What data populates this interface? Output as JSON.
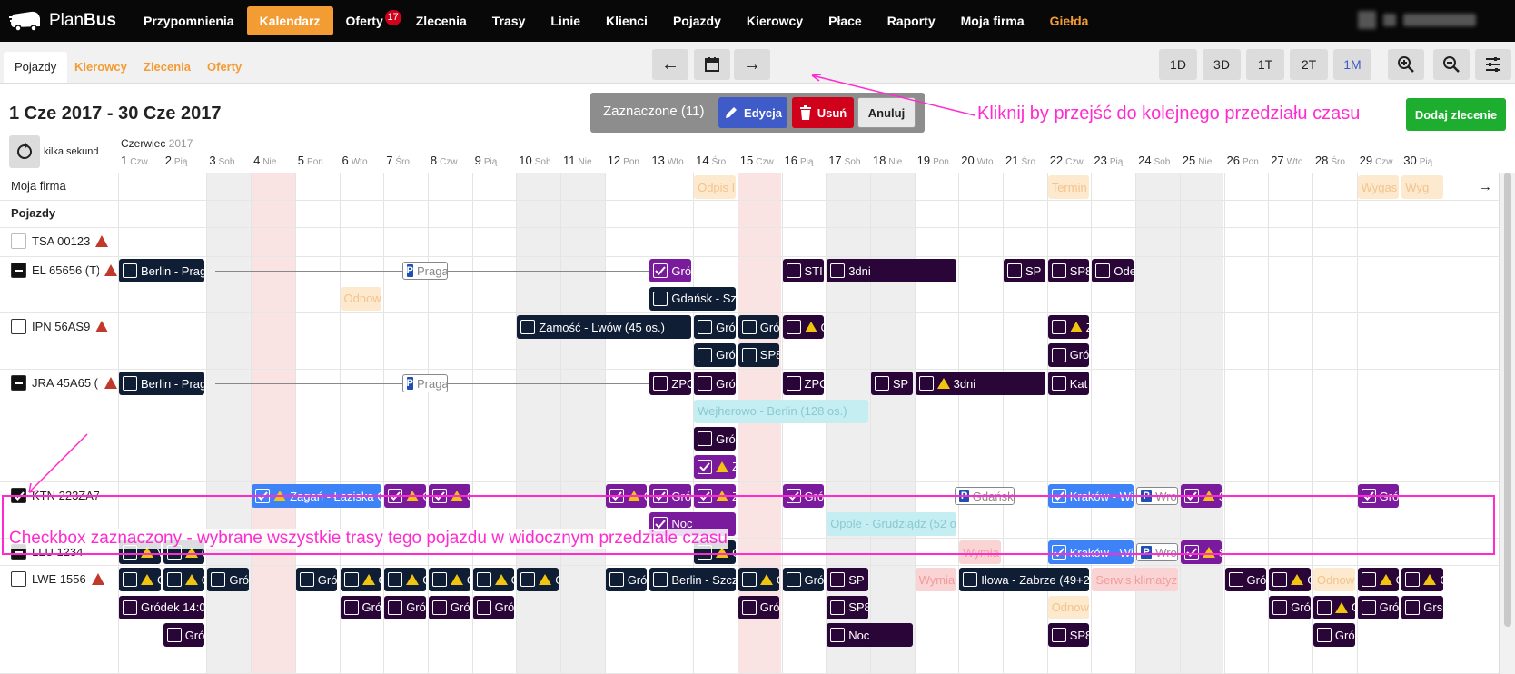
{
  "app": {
    "logo_text_1": "Plan",
    "logo_text_2": "Bus"
  },
  "nav": [
    {
      "label": "Przypomnienia"
    },
    {
      "label": "Kalendarz",
      "active": true
    },
    {
      "label": "Oferty",
      "badge": "17"
    },
    {
      "label": "Zlecenia"
    },
    {
      "label": "Trasy"
    },
    {
      "label": "Linie"
    },
    {
      "label": "Klienci"
    },
    {
      "label": "Pojazdy"
    },
    {
      "label": "Kierowcy"
    },
    {
      "label": "Płace"
    },
    {
      "label": "Raporty"
    },
    {
      "label": "Moja firma"
    },
    {
      "label": "Giełda",
      "gielda": true
    }
  ],
  "tabs": [
    {
      "label": "Pojazdy",
      "active": true
    },
    {
      "label": "Kierowcy"
    },
    {
      "label": "Zlecenia"
    },
    {
      "label": "Oferty"
    }
  ],
  "views": [
    "1D",
    "3D",
    "1T",
    "2T",
    "1M"
  ],
  "selected_view": "1M",
  "date_range": "1 Cze 2017 - 30 Cze 2017",
  "selection": {
    "label": "Zaznaczone (11)",
    "edit": "Edycja",
    "delete": "Usuń",
    "cancel": "Anuluj"
  },
  "add_button": "Dodaj zlecenie",
  "refresh_label": "kilka sekund",
  "month": {
    "name": "Czerwiec",
    "year": "2017"
  },
  "annotations": {
    "next": "Kliknij by przejść do kolejnego przedziału czasu",
    "checkbox": "Checkbox zaznaczony - wybrane wszystkie trasy tego pojazdu w widocznym przedziale czasu"
  },
  "days": [
    {
      "n": "1",
      "d": "Czw"
    },
    {
      "n": "2",
      "d": "Pią"
    },
    {
      "n": "3",
      "d": "Sob"
    },
    {
      "n": "4",
      "d": "Nie"
    },
    {
      "n": "5",
      "d": "Pon"
    },
    {
      "n": "6",
      "d": "Wto"
    },
    {
      "n": "7",
      "d": "Śro"
    },
    {
      "n": "8",
      "d": "Czw"
    },
    {
      "n": "9",
      "d": "Pią"
    },
    {
      "n": "10",
      "d": "Sob"
    },
    {
      "n": "11",
      "d": "Nie"
    },
    {
      "n": "12",
      "d": "Pon"
    },
    {
      "n": "13",
      "d": "Wto"
    },
    {
      "n": "14",
      "d": "Śro"
    },
    {
      "n": "15",
      "d": "Czw"
    },
    {
      "n": "16",
      "d": "Pią"
    },
    {
      "n": "17",
      "d": "Sob"
    },
    {
      "n": "18",
      "d": "Nie"
    },
    {
      "n": "19",
      "d": "Pon"
    },
    {
      "n": "20",
      "d": "Wto"
    },
    {
      "n": "21",
      "d": "Śro"
    },
    {
      "n": "22",
      "d": "Czw"
    },
    {
      "n": "23",
      "d": "Pią"
    },
    {
      "n": "24",
      "d": "Sob"
    },
    {
      "n": "25",
      "d": "Nie"
    },
    {
      "n": "26",
      "d": "Pon"
    },
    {
      "n": "27",
      "d": "Wto"
    },
    {
      "n": "28",
      "d": "Śro"
    },
    {
      "n": "29",
      "d": "Czw"
    },
    {
      "n": "30",
      "d": "Pią"
    }
  ],
  "rows": {
    "firma": "Moja firma",
    "section": "Pojazdy",
    "vehicles": [
      "TSA 00123",
      "EL 65656 (T)",
      "IPN 56AS9",
      "JRA 45A65 (I",
      "KTN 223ZA7",
      "LLU 1234",
      "LWE 1556"
    ]
  },
  "events": [
    {
      "day": 14,
      "len": 1,
      "lane": 0,
      "row": "firma",
      "style": "peach",
      "text": "Odpis I"
    },
    {
      "day": 22,
      "len": 1,
      "lane": 0,
      "row": "firma",
      "style": "peach",
      "text": "Termin"
    },
    {
      "day": 29,
      "len": 1,
      "lane": 0,
      "row": "firma",
      "style": "peach",
      "text": "Wygas"
    },
    {
      "day": 30,
      "len": 1,
      "lane": 0,
      "row": "firma",
      "style": "peach",
      "text": "Wyg"
    },
    {
      "day": 1,
      "len": 2,
      "lane": 0,
      "row": 1,
      "style": "navy",
      "cb": "off",
      "text": "Berlin - Prag"
    },
    {
      "day": 7.4,
      "len": 1.1,
      "lane": 0,
      "row": 1,
      "style": "park",
      "text": "Praga"
    },
    {
      "day": 13,
      "len": 1,
      "lane": 0,
      "row": 1,
      "style": "purp",
      "cb": "on",
      "text": "Gró"
    },
    {
      "day": 16,
      "len": 1,
      "lane": 0,
      "row": 1,
      "style": "dkp",
      "cb": "off",
      "text": "STI"
    },
    {
      "day": 17,
      "len": 3,
      "lane": 0,
      "row": 1,
      "style": "dkp",
      "cb": "off",
      "text": "3dni"
    },
    {
      "day": 21,
      "len": 1,
      "lane": 0,
      "row": 1,
      "style": "dkp",
      "cb": "off",
      "text": "SP"
    },
    {
      "day": 22,
      "len": 1,
      "lane": 0,
      "row": 1,
      "style": "dkp",
      "cb": "off",
      "text": "SP8"
    },
    {
      "day": 23,
      "len": 1,
      "lane": 0,
      "row": 1,
      "style": "dkp",
      "cb": "off",
      "text": "Ode"
    },
    {
      "day": 6,
      "len": 1,
      "lane": 1,
      "row": 1,
      "style": "peach",
      "text": "Odnow"
    },
    {
      "day": 13,
      "len": 2,
      "lane": 1,
      "row": 1,
      "style": "navy",
      "cb": "off",
      "text": "Gdańsk - Szc"
    },
    {
      "day": 10,
      "len": 4,
      "lane": 0,
      "row": 2,
      "style": "navy",
      "cb": "off",
      "text": "Zamość - Lwów (45 os.)"
    },
    {
      "day": 14,
      "len": 1,
      "lane": 0,
      "row": 2,
      "style": "navy",
      "cb": "off",
      "text": "Gró"
    },
    {
      "day": 15,
      "len": 1,
      "lane": 0,
      "row": 2,
      "style": "navy",
      "cb": "off",
      "text": "Gró"
    },
    {
      "day": 16,
      "len": 1,
      "lane": 0,
      "row": 2,
      "style": "dkp",
      "cb": "off",
      "warn": true,
      "text": "G"
    },
    {
      "day": 22,
      "len": 1,
      "lane": 0,
      "row": 2,
      "style": "dkp",
      "cb": "off",
      "warn": true,
      "text": "Z"
    },
    {
      "day": 14,
      "len": 1,
      "lane": 1,
      "row": 2,
      "style": "navy",
      "cb": "off",
      "text": "Gró"
    },
    {
      "day": 15,
      "len": 1,
      "lane": 1,
      "row": 2,
      "style": "navy",
      "cb": "off",
      "text": "SP8"
    },
    {
      "day": 22,
      "len": 1,
      "lane": 1,
      "row": 2,
      "style": "dkp",
      "cb": "off",
      "text": "Gró"
    },
    {
      "day": 1,
      "len": 2,
      "lane": 0,
      "row": 3,
      "style": "navy",
      "cb": "off",
      "text": "Berlin - Prag"
    },
    {
      "day": 7.4,
      "len": 1.1,
      "lane": 0,
      "row": 3,
      "style": "park",
      "text": "Praga"
    },
    {
      "day": 13,
      "len": 1,
      "lane": 0,
      "row": 3,
      "style": "dkp",
      "cb": "off",
      "text": "ZPC"
    },
    {
      "day": 14,
      "len": 1,
      "lane": 0,
      "row": 3,
      "style": "dkp",
      "cb": "off",
      "text": "Gró"
    },
    {
      "day": 16,
      "len": 1,
      "lane": 0,
      "row": 3,
      "style": "dkp",
      "cb": "off",
      "text": "ZPC"
    },
    {
      "day": 18,
      "len": 1,
      "lane": 0,
      "row": 3,
      "style": "dkp",
      "cb": "off",
      "text": "SP"
    },
    {
      "day": 19,
      "len": 3,
      "lane": 0,
      "row": 3,
      "style": "dkp",
      "cb": "off",
      "warn": true,
      "text": "3dni"
    },
    {
      "day": 22,
      "len": 1,
      "lane": 0,
      "row": 3,
      "style": "dkp",
      "cb": "off",
      "text": "Kat"
    },
    {
      "day": 14,
      "len": 4,
      "lane": 1,
      "row": 3,
      "style": "cyan",
      "text": "Wejherowo - Berlin (128 os.)"
    },
    {
      "day": 14,
      "len": 1,
      "lane": 2,
      "row": 3,
      "style": "dkp",
      "cb": "off",
      "text": "Gró"
    },
    {
      "day": 14,
      "len": 1,
      "lane": 3,
      "row": 3,
      "style": "purp",
      "cb": "on",
      "warn": true,
      "text": "Z"
    },
    {
      "day": 4,
      "len": 3,
      "lane": 0,
      "row": 4,
      "style": "blue",
      "cb": "on",
      "warn": true,
      "text": "Żagań - Łaziska Gó"
    },
    {
      "day": 7,
      "len": 1,
      "lane": 0,
      "row": 4,
      "style": "purp",
      "cb": "on",
      "warn": true,
      "text": "G"
    },
    {
      "day": 8,
      "len": 1,
      "lane": 0,
      "row": 4,
      "style": "purp",
      "cb": "on",
      "warn": true,
      "text": "G"
    },
    {
      "day": 12,
      "len": 1,
      "lane": 0,
      "row": 4,
      "style": "purp",
      "cb": "on",
      "warn": true,
      "text": "G"
    },
    {
      "day": 13,
      "len": 1,
      "lane": 0,
      "row": 4,
      "style": "purp",
      "cb": "on",
      "text": "Gró"
    },
    {
      "day": 14,
      "len": 1,
      "lane": 0,
      "row": 4,
      "style": "purp",
      "cb": "on",
      "warn": true,
      "text": "Z"
    },
    {
      "day": 16,
      "len": 1,
      "lane": 0,
      "row": 4,
      "style": "purp",
      "cb": "on",
      "text": "Gró"
    },
    {
      "day": 19.9,
      "len": 1.4,
      "lane": 0,
      "row": 4,
      "style": "park",
      "text": "Gdańsk"
    },
    {
      "day": 22,
      "len": 2,
      "lane": 0,
      "row": 4,
      "style": "blue",
      "cb": "on",
      "text": "Kraków - Wi"
    },
    {
      "day": 24,
      "len": 1,
      "lane": 0,
      "row": 4,
      "style": "park",
      "text": "Wro"
    },
    {
      "day": 25,
      "len": 1,
      "lane": 0,
      "row": 4,
      "style": "purp",
      "cb": "on",
      "warn": true,
      "text": "S"
    },
    {
      "day": 29,
      "len": 1,
      "lane": 0,
      "row": 4,
      "style": "purp",
      "cb": "on",
      "text": "Gró"
    },
    {
      "day": 13,
      "len": 2,
      "lane": 1,
      "row": 4,
      "style": "purp",
      "cb": "on",
      "text": "Noc"
    },
    {
      "day": 17,
      "len": 3,
      "lane": 1,
      "row": 4,
      "style": "cyan",
      "text": "Opole - Grudziądz (52 os."
    },
    {
      "day": 1,
      "len": 1,
      "lane": 0,
      "row": 5,
      "style": "navy",
      "cb": "off",
      "warn": true,
      "text": "V"
    },
    {
      "day": 2,
      "len": 1,
      "lane": 0,
      "row": 5,
      "style": "navy",
      "cb": "off",
      "warn": true,
      "text": "G"
    },
    {
      "day": 14,
      "len": 1,
      "lane": 0,
      "row": 5,
      "style": "navy",
      "cb": "off",
      "warn": true,
      "text": "G"
    },
    {
      "day": 20,
      "len": 1,
      "lane": 0,
      "row": 5,
      "style": "pink",
      "text": "Wymia"
    },
    {
      "day": 22,
      "len": 2,
      "lane": 0,
      "row": 5,
      "style": "blue",
      "cb": "on",
      "text": "Kraków - Wi"
    },
    {
      "day": 24,
      "len": 1,
      "lane": 0,
      "row": 5,
      "style": "park",
      "text": "Wro"
    },
    {
      "day": 25,
      "len": 1,
      "lane": 0,
      "row": 5,
      "style": "purp",
      "cb": "on",
      "warn": true,
      "text": "S"
    },
    {
      "day": 1,
      "len": 1,
      "lane": 0,
      "row": 6,
      "style": "navy",
      "cb": "off",
      "warn": true,
      "text": "G"
    },
    {
      "day": 2,
      "len": 1,
      "lane": 0,
      "row": 6,
      "style": "navy",
      "cb": "off",
      "warn": true,
      "text": "G"
    },
    {
      "day": 3,
      "len": 1,
      "lane": 0,
      "row": 6,
      "style": "navy",
      "cb": "off",
      "text": "Gró"
    },
    {
      "day": 5,
      "len": 1,
      "lane": 0,
      "row": 6,
      "style": "navy",
      "cb": "off",
      "text": "Gró"
    },
    {
      "day": 6,
      "len": 1,
      "lane": 0,
      "row": 6,
      "style": "navy",
      "cb": "off",
      "warn": true,
      "text": "G"
    },
    {
      "day": 7,
      "len": 1,
      "lane": 0,
      "row": 6,
      "style": "navy",
      "cb": "off",
      "warn": true,
      "text": "G"
    },
    {
      "day": 8,
      "len": 1,
      "lane": 0,
      "row": 6,
      "style": "navy",
      "cb": "off",
      "warn": true,
      "text": "G"
    },
    {
      "day": 9,
      "len": 1,
      "lane": 0,
      "row": 6,
      "style": "navy",
      "cb": "off",
      "warn": true,
      "text": "G"
    },
    {
      "day": 10,
      "len": 1,
      "lane": 0,
      "row": 6,
      "style": "navy",
      "cb": "off",
      "warn": true,
      "text": "G"
    },
    {
      "day": 12,
      "len": 1,
      "lane": 0,
      "row": 6,
      "style": "navy",
      "cb": "off",
      "text": "Gró"
    },
    {
      "day": 13,
      "len": 2,
      "lane": 0,
      "row": 6,
      "style": "navy",
      "cb": "off",
      "text": "Berlin - Szcz"
    },
    {
      "day": 15,
      "len": 1,
      "lane": 0,
      "row": 6,
      "style": "navy",
      "cb": "off",
      "warn": true,
      "text": "G"
    },
    {
      "day": 16,
      "len": 1,
      "lane": 0,
      "row": 6,
      "style": "navy",
      "cb": "off",
      "text": "Gró"
    },
    {
      "day": 17,
      "len": 1,
      "lane": 0,
      "row": 6,
      "style": "dkp",
      "cb": "off",
      "text": "SP"
    },
    {
      "day": 19,
      "len": 1,
      "lane": 0,
      "row": 6,
      "style": "pink",
      "text": "Wymia"
    },
    {
      "day": 20,
      "len": 3,
      "lane": 0,
      "row": 6,
      "style": "navy",
      "cb": "off",
      "text": "Iłowa - Zabrze (49+2"
    },
    {
      "day": 23,
      "len": 2,
      "lane": 0,
      "row": 6,
      "style": "pink",
      "text": "Serwis klimatyz"
    },
    {
      "day": 26,
      "len": 1,
      "lane": 0,
      "row": 6,
      "style": "dkp",
      "cb": "off",
      "text": "Gró"
    },
    {
      "day": 27,
      "len": 1,
      "lane": 0,
      "row": 6,
      "style": "dkp",
      "cb": "off",
      "warn": true,
      "text": "G"
    },
    {
      "day": 28,
      "len": 1,
      "lane": 0,
      "row": 6,
      "style": "peach",
      "text": "Odnow"
    },
    {
      "day": 29,
      "len": 1,
      "lane": 0,
      "row": 6,
      "style": "dkp",
      "cb": "off",
      "warn": true,
      "text": "G"
    },
    {
      "day": 30,
      "len": 1,
      "lane": 0,
      "row": 6,
      "style": "dkp",
      "cb": "off",
      "warn": true,
      "text": "G"
    },
    {
      "day": 1,
      "len": 2,
      "lane": 1,
      "row": 6,
      "style": "dkp",
      "cb": "off",
      "text": "Gródek 14:0"
    },
    {
      "day": 6,
      "len": 1,
      "lane": 1,
      "row": 6,
      "style": "dkp",
      "cb": "off",
      "text": "Gró"
    },
    {
      "day": 7,
      "len": 1,
      "lane": 1,
      "row": 6,
      "style": "dkp",
      "cb": "off",
      "text": "Gró"
    },
    {
      "day": 8,
      "len": 1,
      "lane": 1,
      "row": 6,
      "style": "dkp",
      "cb": "off",
      "text": "Gró"
    },
    {
      "day": 9,
      "len": 1,
      "lane": 1,
      "row": 6,
      "style": "dkp",
      "cb": "off",
      "text": "Gró"
    },
    {
      "day": 15,
      "len": 1,
      "lane": 1,
      "row": 6,
      "style": "dkp",
      "cb": "off",
      "text": "Gró"
    },
    {
      "day": 17,
      "len": 1,
      "lane": 1,
      "row": 6,
      "style": "dkp",
      "cb": "off",
      "text": "SP8"
    },
    {
      "day": 22,
      "len": 1,
      "lane": 1,
      "row": 6,
      "style": "peach",
      "text": "Odnow"
    },
    {
      "day": 27,
      "len": 1,
      "lane": 1,
      "row": 6,
      "style": "dkp",
      "cb": "off",
      "text": "Gró"
    },
    {
      "day": 28,
      "len": 1,
      "lane": 1,
      "row": 6,
      "style": "dkp",
      "cb": "off",
      "warn": true,
      "text": "G"
    },
    {
      "day": 29,
      "len": 1,
      "lane": 1,
      "row": 6,
      "style": "dkp",
      "cb": "off",
      "text": "Gró"
    },
    {
      "day": 30,
      "len": 1,
      "lane": 1,
      "row": 6,
      "style": "dkp",
      "cb": "off",
      "text": "Grs"
    },
    {
      "day": 2,
      "len": 1,
      "lane": 2,
      "row": 6,
      "style": "dkp",
      "cb": "off",
      "text": "Gró"
    },
    {
      "day": 17,
      "len": 2,
      "lane": 2,
      "row": 6,
      "style": "dkp",
      "cb": "off",
      "text": "Noc"
    },
    {
      "day": 22,
      "len": 1,
      "lane": 2,
      "row": 6,
      "style": "dkp",
      "cb": "off",
      "text": "SP8"
    },
    {
      "day": 28,
      "len": 1,
      "lane": 2,
      "row": 6,
      "style": "dkp",
      "cb": "off",
      "text": "Gró"
    }
  ]
}
